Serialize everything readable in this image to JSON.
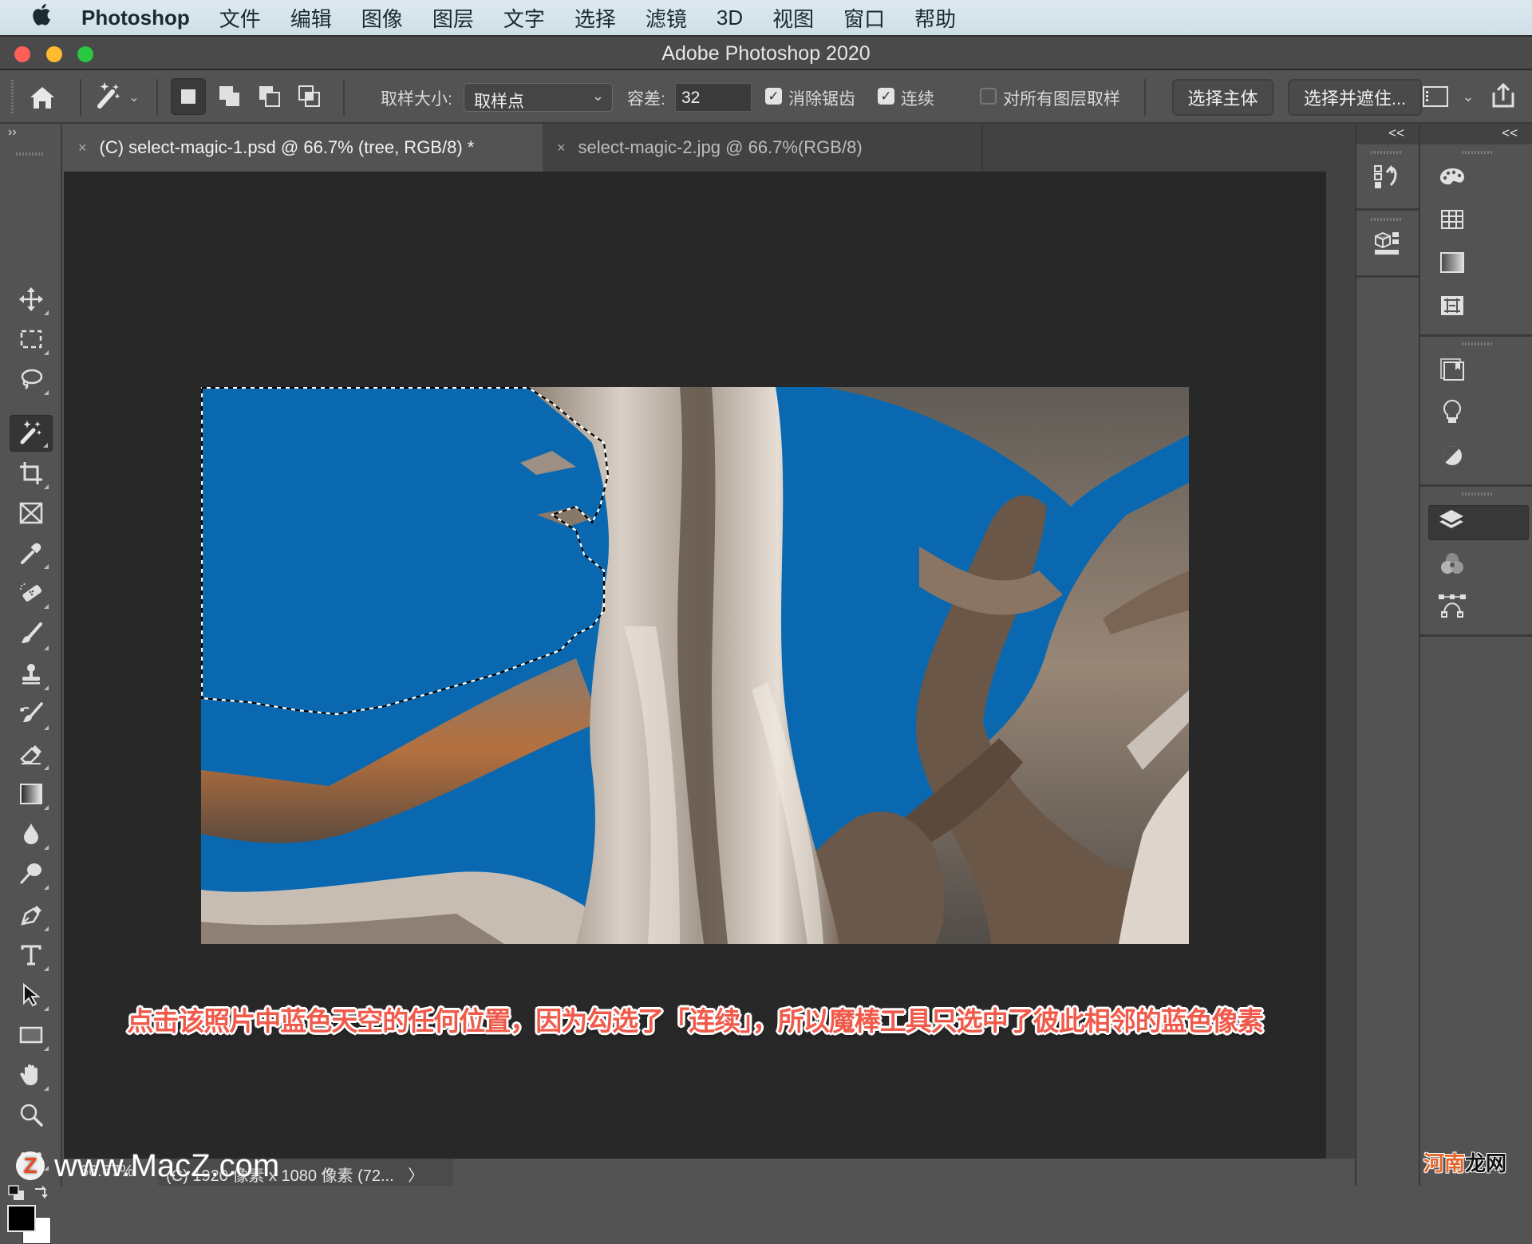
{
  "menubar": {
    "app_name": "Photoshop",
    "items": [
      "文件",
      "编辑",
      "图像",
      "图层",
      "文字",
      "选择",
      "滤镜",
      "3D",
      "视图",
      "窗口",
      "帮助"
    ]
  },
  "window": {
    "title": "Adobe Photoshop 2020"
  },
  "options_bar": {
    "sample_size_label": "取样大小:",
    "sample_size_value": "取样点",
    "tolerance_label": "容差:",
    "tolerance_value": "32",
    "anti_alias_label": "消除锯齿",
    "anti_alias_checked": true,
    "contiguous_label": "连续",
    "contiguous_checked": true,
    "sample_all_layers_label": "对所有图层取样",
    "sample_all_layers_checked": false,
    "select_subject_label": "选择主体",
    "select_and_mask_label": "选择并遮住...",
    "selection_modes": [
      "new-selection",
      "add-to-selection",
      "subtract-from-selection",
      "intersect-selection"
    ],
    "active_mode": "new-selection",
    "current_tool_icon": "magic-wand-icon"
  },
  "tabs": [
    {
      "label": "(C) select-magic-1.psd @ 66.7% (tree, RGB/8) *",
      "active": true
    },
    {
      "label": "select-magic-2.jpg @ 66.7%(RGB/8)",
      "active": false
    }
  ],
  "toolbar": {
    "tools": [
      {
        "name": "move-tool",
        "icon": "move-icon"
      },
      {
        "name": "marquee-tool",
        "icon": "rect-marquee-icon"
      },
      {
        "name": "lasso-tool",
        "icon": "lasso-icon"
      },
      {
        "name": "magic-wand-tool",
        "icon": "magic-wand-icon",
        "active": true
      },
      {
        "name": "crop-tool",
        "icon": "crop-icon"
      },
      {
        "name": "frame-tool",
        "icon": "frame-icon"
      },
      {
        "name": "eyedropper-tool",
        "icon": "eyedropper-icon"
      },
      {
        "name": "healing-brush-tool",
        "icon": "bandage-icon"
      },
      {
        "name": "brush-tool",
        "icon": "brush-icon"
      },
      {
        "name": "clone-stamp-tool",
        "icon": "stamp-icon"
      },
      {
        "name": "history-brush-tool",
        "icon": "history-brush-icon"
      },
      {
        "name": "eraser-tool",
        "icon": "eraser-icon"
      },
      {
        "name": "gradient-tool",
        "icon": "gradient-icon"
      },
      {
        "name": "blur-tool",
        "icon": "drop-icon"
      },
      {
        "name": "dodge-tool",
        "icon": "dodge-icon"
      },
      {
        "name": "pen-tool",
        "icon": "pen-icon"
      },
      {
        "name": "type-tool",
        "icon": "type-icon"
      },
      {
        "name": "path-selection-tool",
        "icon": "arrow-icon"
      },
      {
        "name": "rectangle-tool",
        "icon": "rectangle-icon"
      },
      {
        "name": "hand-tool",
        "icon": "hand-icon"
      },
      {
        "name": "zoom-tool",
        "icon": "magnifier-icon"
      },
      {
        "name": "edit-toolbar",
        "icon": "more-icon"
      }
    ],
    "foreground_color": "#000000",
    "background_color": "#ffffff"
  },
  "canvas": {
    "caption": "点击该照片中蓝色天空的任何位置，因为勾选了「连续」，所以魔棒工具只选中了彼此相邻的蓝色像素",
    "sky_color": "#0a68b0",
    "caption_color": "#f05a4a"
  },
  "statusbar": {
    "zoom": "66.67%",
    "doc_info": "(C) 1920 像素 x 1080 像素 (72...",
    "arrow": "〉"
  },
  "right_panels": {
    "collapse_label": "<<",
    "column1": [
      {
        "name": "history-panel",
        "icon": "history-icon"
      },
      {
        "name": "3d-panel",
        "icon": "cube-icon"
      }
    ],
    "column2": [
      {
        "name": "color-panel",
        "icon": "palette-icon"
      },
      {
        "name": "swatches-panel",
        "icon": "swatches-icon"
      },
      {
        "name": "gradients-panel",
        "icon": "gradient-swatch-icon"
      },
      {
        "name": "patterns-panel",
        "icon": "patterns-icon"
      },
      {
        "name": "libraries-panel",
        "icon": "libraries-icon"
      },
      {
        "name": "learn-panel",
        "icon": "lightbulb-icon"
      },
      {
        "name": "adjustments-panel",
        "icon": "adjustments-icon"
      },
      {
        "name": "layers-panel",
        "icon": "layers-icon",
        "active": true
      },
      {
        "name": "channels-panel",
        "icon": "channels-icon"
      },
      {
        "name": "paths-panel",
        "icon": "paths-icon"
      }
    ]
  },
  "watermarks": {
    "macz": "www.MacZ.com",
    "macz_logo": "Z",
    "henan_part1": "河南",
    "henan_part2": "龙网"
  }
}
